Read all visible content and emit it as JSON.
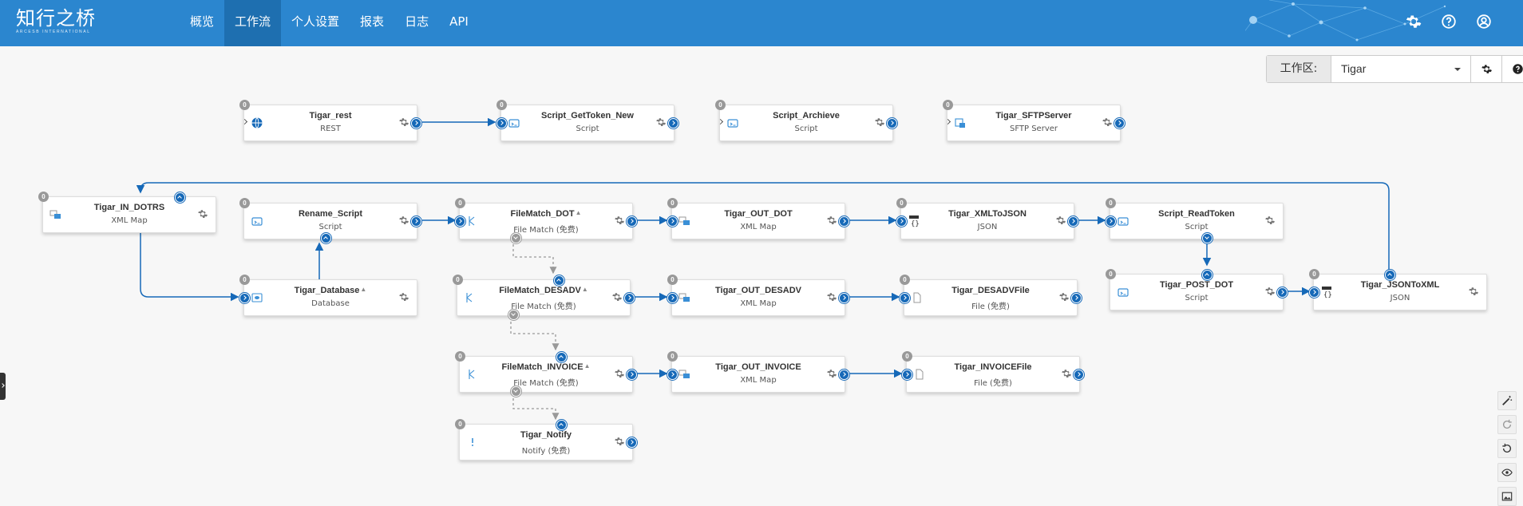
{
  "app": {
    "logo_text": "知行之桥",
    "logo_subtext": "ARCESB INTERNATIONAL"
  },
  "nav": [
    {
      "label": "概览",
      "active": false
    },
    {
      "label": "工作流",
      "active": true
    },
    {
      "label": "个人设置",
      "active": false
    },
    {
      "label": "报表",
      "active": false
    },
    {
      "label": "日志",
      "active": false
    },
    {
      "label": "API",
      "active": false
    }
  ],
  "top_icons": [
    "gear-icon",
    "help-icon",
    "user-icon"
  ],
  "toolbar": {
    "workspace_label": "工作区:",
    "workspace_value": "Tigar"
  },
  "colors": {
    "header": "#2b86cf",
    "nav_active": "#1e6fb0",
    "port": "#1669b8",
    "badge": "#999999",
    "canvas": "#f7f7f7"
  },
  "nodes": [
    {
      "id": "tigar_rest",
      "name": "Tigar_rest",
      "type": "REST",
      "count": "0",
      "icon": "globe-icon",
      "warn": false
    },
    {
      "id": "script_gettoken_new",
      "name": "Script_GetToken_New",
      "type": "Script",
      "count": "0",
      "icon": "script-icon",
      "warn": false
    },
    {
      "id": "script_archieve",
      "name": "Script_Archieve",
      "type": "Script",
      "count": "0",
      "icon": "script-icon",
      "warn": false
    },
    {
      "id": "tigar_sftpserver",
      "name": "Tigar_SFTPServer",
      "type": "SFTP Server",
      "count": "0",
      "icon": "sftp-icon",
      "warn": false
    },
    {
      "id": "tigar_in_dotrs",
      "name": "Tigar_IN_DOTRS",
      "type": "XML Map",
      "count": "0",
      "icon": "xml-map-icon",
      "warn": false
    },
    {
      "id": "rename_script",
      "name": "Rename_Script",
      "type": "Script",
      "count": "0",
      "icon": "script-icon",
      "warn": false
    },
    {
      "id": "filematch_dot",
      "name": "FileMatch_DOT",
      "type": "File Match (免费)",
      "count": "0",
      "icon": "file-match-icon",
      "warn": true
    },
    {
      "id": "tigar_out_dot",
      "name": "Tigar_OUT_DOT",
      "type": "XML Map",
      "count": "0",
      "icon": "xml-map-icon",
      "warn": false
    },
    {
      "id": "tigar_xmltojson",
      "name": "Tigar_XMLToJSON",
      "type": "JSON",
      "count": "0",
      "icon": "json-icon",
      "warn": false
    },
    {
      "id": "script_readtoken",
      "name": "Script_ReadToken",
      "type": "Script",
      "count": "0",
      "icon": "script-icon",
      "warn": false
    },
    {
      "id": "tigar_database",
      "name": "Tigar_Database",
      "type": "Database",
      "count": "0",
      "icon": "database-icon",
      "warn": true
    },
    {
      "id": "filematch_desadv",
      "name": "FileMatch_DESADV",
      "type": "File Match (免费)",
      "count": "0",
      "icon": "file-match-icon",
      "warn": true
    },
    {
      "id": "tigar_out_desadv",
      "name": "Tigar_OUT_DESADV",
      "type": "XML Map",
      "count": "0",
      "icon": "xml-map-icon",
      "warn": false
    },
    {
      "id": "tigar_desadvfile",
      "name": "Tigar_DESADVFile",
      "type": "File (免费)",
      "count": "0",
      "icon": "file-icon",
      "warn": false
    },
    {
      "id": "tigar_post_dot",
      "name": "Tigar_POST_DOT",
      "type": "Script",
      "count": "0",
      "icon": "script-icon",
      "warn": false
    },
    {
      "id": "tigar_jsontoxml",
      "name": "Tigar_JSONToXML",
      "type": "JSON",
      "count": "0",
      "icon": "json-icon",
      "warn": false
    },
    {
      "id": "filematch_invoice",
      "name": "FileMatch_INVOICE",
      "type": "File Match (免费)",
      "count": "0",
      "icon": "file-match-icon",
      "warn": true
    },
    {
      "id": "tigar_out_invoice",
      "name": "Tigar_OUT_INVOICE",
      "type": "XML Map",
      "count": "0",
      "icon": "xml-map-icon",
      "warn": false
    },
    {
      "id": "tigar_invoicefile",
      "name": "Tigar_INVOICEFile",
      "type": "File (免费)",
      "count": "0",
      "icon": "file-icon",
      "warn": false
    },
    {
      "id": "tigar_notify",
      "name": "Tigar_Notify",
      "type": "Notify (免费)",
      "count": "0",
      "icon": "notify-icon",
      "warn": false
    }
  ],
  "right_tools": [
    "magic-wand-icon",
    "redo-icon",
    "undo-icon",
    "eye-icon",
    "image-icon"
  ]
}
